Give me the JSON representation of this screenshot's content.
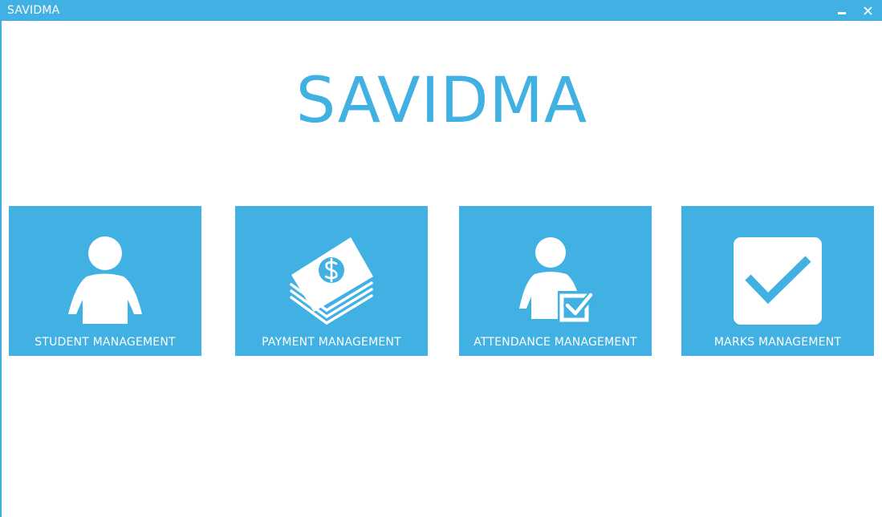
{
  "window": {
    "title": "SAVIDMA",
    "accent_color": "#41b0e3",
    "minimize_icon": "minimize-icon",
    "close_icon": "close-icon"
  },
  "main": {
    "heading": "SAVIDMA",
    "tiles": [
      {
        "label": "STUDENT MANAGEMENT",
        "icon": "student-icon"
      },
      {
        "label": "PAYMENT MANAGEMENT",
        "icon": "money-icon"
      },
      {
        "label": "ATTENDANCE MANAGEMENT",
        "icon": "attendance-icon"
      },
      {
        "label": "MARKS MANAGEMENT",
        "icon": "checkmark-icon"
      }
    ]
  }
}
